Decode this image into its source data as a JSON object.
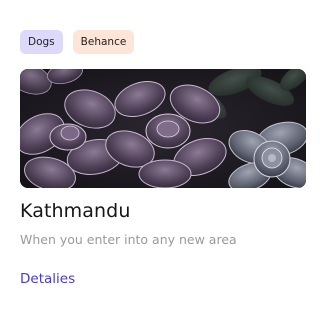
{
  "card": {
    "tags": [
      {
        "label": "Dogs"
      },
      {
        "label": "Behance"
      }
    ],
    "image": {
      "subject": "succulent-plants-photo"
    },
    "title": "Kathmandu",
    "subtitle": "When you enter into any new area",
    "link_label": "Detalies"
  },
  "colors": {
    "tag_primary_bg": "#dcd9fb",
    "tag_secondary_bg": "#fde5d7",
    "link": "#4a3ad0",
    "subtitle": "#9a9a9a",
    "title": "#161616"
  }
}
